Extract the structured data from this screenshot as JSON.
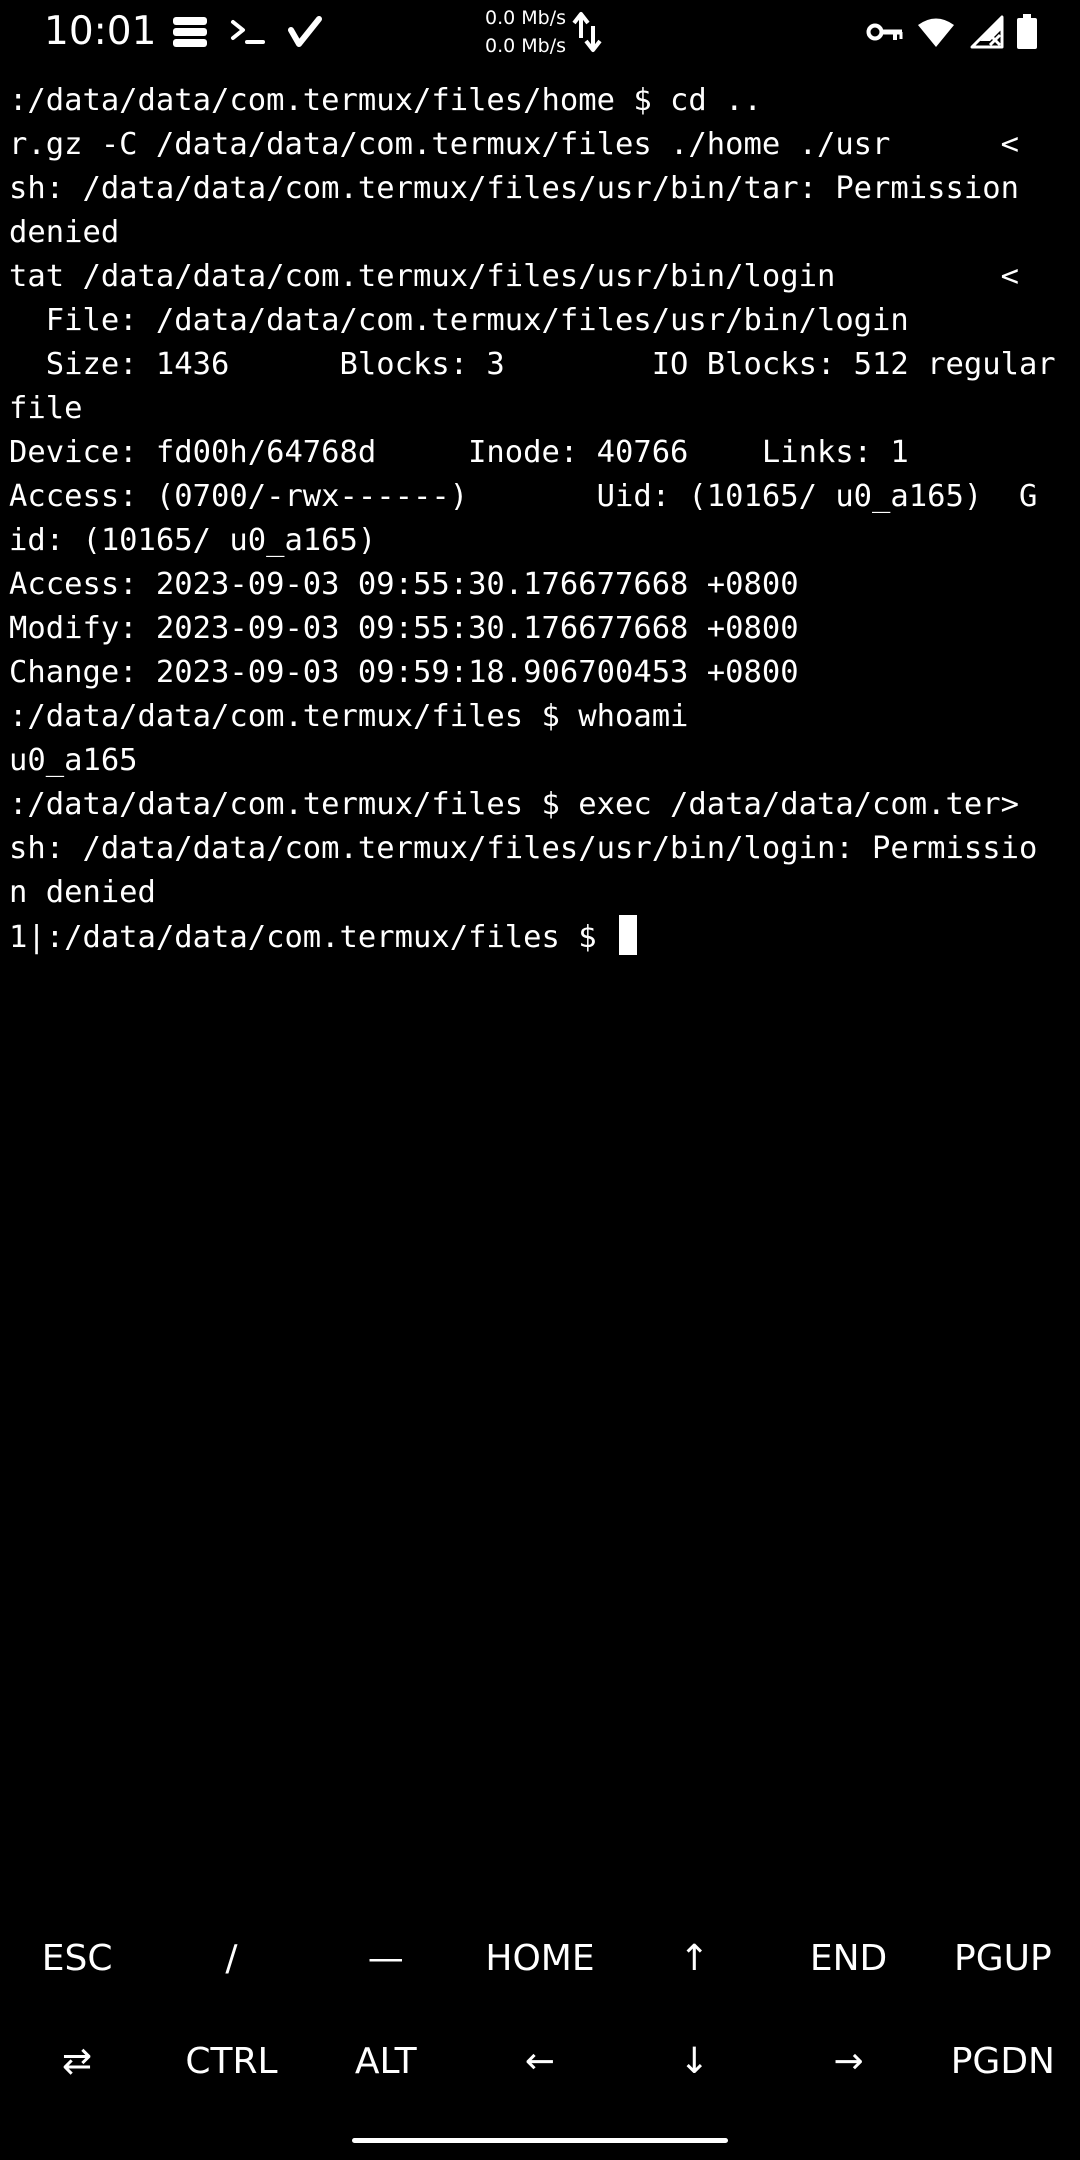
{
  "status_bar": {
    "time": "10:01",
    "net_speed_up": "0.0 Mb/s",
    "net_speed_down": "0.0 Mb/s",
    "icons_left": [
      "storage-icon",
      "terminal-prompt-icon",
      "check-icon"
    ],
    "icons_right": [
      "vpn-key-icon",
      "wifi-icon",
      "no-signal-icon",
      "battery-icon"
    ]
  },
  "terminal": {
    "lines": [
      ":/data/data/com.termux/files/home $ cd ..",
      "r.gz -C /data/data/com.termux/files ./home ./usr      <",
      "sh: /data/data/com.termux/files/usr/bin/tar: Permission",
      "denied",
      "tat /data/data/com.termux/files/usr/bin/login         <",
      "  File: /data/data/com.termux/files/usr/bin/login",
      "  Size: 1436      Blocks: 3        IO Blocks: 512 regular",
      "file",
      "Device: fd00h/64768d     Inode: 40766    Links: 1",
      "Access: (0700/-rwx------)       Uid: (10165/ u0_a165)  G",
      "id: (10165/ u0_a165)",
      "Access: 2023-09-03 09:55:30.176677668 +0800",
      "Modify: 2023-09-03 09:55:30.176677668 +0800",
      "Change: 2023-09-03 09:59:18.906700453 +0800",
      ":/data/data/com.termux/files $ whoami",
      "u0_a165",
      ":/data/data/com.termux/files $ exec /data/data/com.ter>",
      "sh: /data/data/com.termux/files/usr/bin/login: Permissio",
      "n denied"
    ],
    "prompt": "1|:/data/data/com.termux/files $ "
  },
  "extra_keys": {
    "row1": [
      "ESC",
      "/",
      "—",
      "HOME",
      "↑",
      "END",
      "PGUP"
    ],
    "row2": [
      "⇄",
      "CTRL",
      "ALT",
      "←",
      "↓",
      "→",
      "PGDN"
    ]
  }
}
